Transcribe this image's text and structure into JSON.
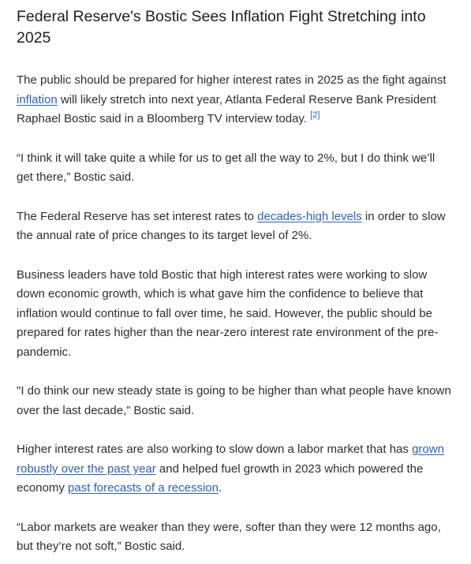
{
  "article": {
    "title": "Federal Reserve's Bostic Sees Inflation Fight Stretching into 2025",
    "p1": {
      "t1": "The public should be prepared for higher interest rates in 2025 as the fight against ",
      "link": "inflation",
      "t2": " will likely stretch into next year, Atlanta Federal Reserve Bank President Raphael Bostic said in a Bloomberg TV interview today. ",
      "footnote": "[2]"
    },
    "p2": "“I think it will take quite a while for us to get all the way to 2%, but I do think we’ll get there,” Bostic said.",
    "p3": {
      "t1": "The Federal Reserve has set interest rates to ",
      "link": "decades-high levels",
      "t2": " in order to slow the annual rate of price changes to its target level of 2%."
    },
    "p4": "Business leaders have told Bostic that high interest rates were working to slow down economic growth, which is what gave him the confidence to believe that inflation would continue to fall over time, he said. However, the public should be prepared for rates higher than the near-zero interest rate environment of the pre-pandemic.",
    "p5": "\"I do think our new steady state is going to be higher than what people have known over the last decade,” Bostic said.",
    "p6": {
      "t1": "Higher interest rates are also working to slow down a labor market that has ",
      "link1": "grown robustly over the past year",
      "t2": " and helped fuel growth in 2023 which powered the economy ",
      "link2": "past forecasts of a recession",
      "t3": "."
    },
    "p7": "“Labor markets are weaker than they were, softer than they were 12 months ago, but they’re not soft,” Bostic said."
  },
  "colors": {
    "link": "#2b5fbd",
    "text": "#2e2e2e",
    "heading": "#1f1f1f",
    "background": "#ffffff"
  }
}
